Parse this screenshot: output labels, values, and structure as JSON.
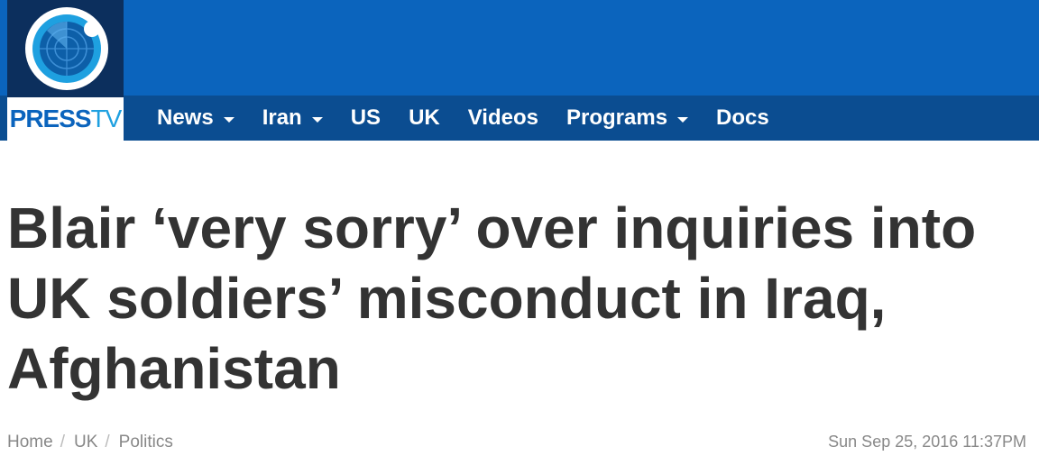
{
  "site": {
    "logo_word_press": "PRESS",
    "logo_word_tv": "TV",
    "logo_icon": "globe-radar-icon",
    "colors": {
      "top_band": "#0b64bd",
      "nav_band": "#0b4d91",
      "logo_dark": "#0c2f5d",
      "headline_text": "#333333",
      "meta_text": "#888888"
    }
  },
  "nav": {
    "items": [
      {
        "label": "News",
        "dropdown": true
      },
      {
        "label": "Iran",
        "dropdown": true
      },
      {
        "label": "US",
        "dropdown": false
      },
      {
        "label": "UK",
        "dropdown": false
      },
      {
        "label": "Videos",
        "dropdown": false
      },
      {
        "label": "Programs",
        "dropdown": true
      },
      {
        "label": "Docs",
        "dropdown": false
      }
    ],
    "dropdown_icon": "caret-down-icon"
  },
  "article": {
    "headline": "Blair ‘very sorry’ over inquiries into UK soldiers’ misconduct in Iraq, Afghanistan",
    "breadcrumb": [
      "Home",
      "UK",
      "Politics"
    ],
    "breadcrumb_separator": "/",
    "timestamp": "Sun Sep 25, 2016 11:37PM"
  }
}
